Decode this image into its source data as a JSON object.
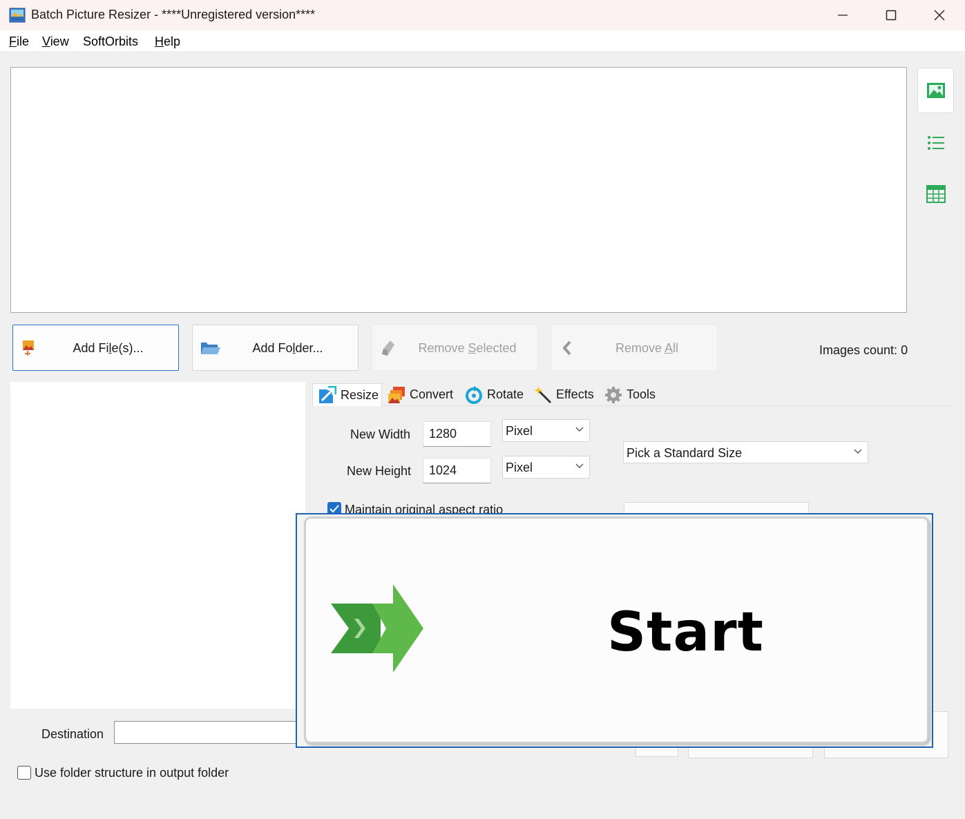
{
  "window": {
    "title": "Batch Picture Resizer - ****Unregistered version****",
    "minimize_glyph": "—",
    "maximize_glyph": "☐",
    "close_glyph": "✕"
  },
  "menu": [
    {
      "ul": "F",
      "rest": "ile"
    },
    {
      "ul": "V",
      "rest": "iew"
    },
    {
      "ul": "",
      "rest": "SoftOrbits"
    },
    {
      "ul": "H",
      "rest": "elp"
    }
  ],
  "view_buttons": [
    "thumbnails-icon",
    "list-icon",
    "table-icon"
  ],
  "actions": {
    "add_files": {
      "pre": "Add Fi",
      "ul": "l",
      "post": "e(s)..."
    },
    "add_folder": {
      "pre": "Add Fo",
      "ul": "l",
      "post": "der..."
    },
    "remove_selected": {
      "pre": "Remove ",
      "ul": "S",
      "post": "elected"
    },
    "remove_all": {
      "pre": "Remove ",
      "ul": "A",
      "post": "ll"
    }
  },
  "images_count": "Images count: 0",
  "tabs": [
    {
      "label": "Resize",
      "icon": "resize-icon"
    },
    {
      "label": "Convert",
      "icon": "convert-icon"
    },
    {
      "label": "Rotate",
      "icon": "rotate-icon"
    },
    {
      "label": "Effects",
      "icon": "effects-icon"
    },
    {
      "label": "Tools",
      "icon": "tools-icon"
    }
  ],
  "resize": {
    "new_width_label": "New Width",
    "new_width_value": "1280",
    "width_unit": "Pixel",
    "new_height_label": "New Height",
    "new_height_value": "1024",
    "height_unit": "Pixel",
    "standard_size": "Pick a Standard Size",
    "maintain_aspect_label": "Maintain original aspect ratio",
    "maintain_aspect_checked": true
  },
  "destination": {
    "label": "Destination",
    "value": ""
  },
  "use_folder_structure": {
    "label": "Use folder structure in output folder",
    "checked": false
  },
  "start_button": {
    "label": "Start",
    "icon": "start-arrow-icon"
  },
  "colors": {
    "accent": "#1e63b5",
    "start_green_dark": "#3d9a3a",
    "start_green_light": "#5fb84a"
  }
}
